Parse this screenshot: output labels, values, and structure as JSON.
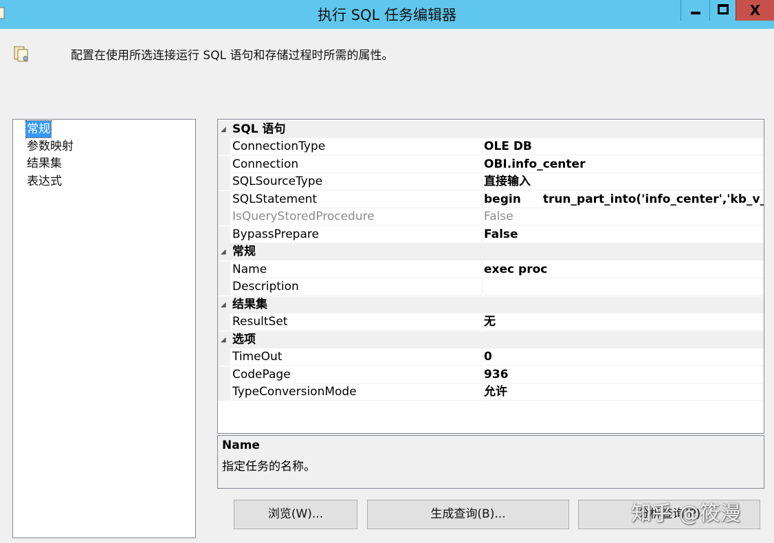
{
  "window": {
    "title": "执行 SQL 任务编辑器",
    "buttons": {
      "min_icon": "minimize-icon",
      "max_icon": "maximize-icon",
      "close_label": "X"
    }
  },
  "header": {
    "icon": "task-page-icon",
    "text": "配置在使用所选连接运行 SQL 语句和存储过程时所需的属性。"
  },
  "nav": {
    "items": [
      {
        "label": "常规",
        "selected": true
      },
      {
        "label": "参数映射",
        "selected": false
      },
      {
        "label": "结果集",
        "selected": false
      },
      {
        "label": "表达式",
        "selected": false
      }
    ]
  },
  "grid": {
    "categories": [
      {
        "label": "SQL 语句",
        "rows": [
          {
            "name": "ConnectionType",
            "value": "OLE DB"
          },
          {
            "name": "Connection",
            "value": "OBI.info_center"
          },
          {
            "name": "SQLSourceType",
            "value": "直接输入"
          },
          {
            "name": "SQLStatement",
            "value": "begin",
            "value2": "trun_part_into('info_center','kb_v_dr"
          },
          {
            "name": "IsQueryStoredProcedure",
            "value": "False",
            "disabled": true
          },
          {
            "name": "BypassPrepare",
            "value": "False"
          }
        ]
      },
      {
        "label": "常规",
        "rows": [
          {
            "name": "Name",
            "value": "exec proc"
          },
          {
            "name": "Description",
            "value": ""
          }
        ]
      },
      {
        "label": "结果集",
        "rows": [
          {
            "name": "ResultSet",
            "value": "无"
          }
        ]
      },
      {
        "label": "选项",
        "rows": [
          {
            "name": "TimeOut",
            "value": "0"
          },
          {
            "name": "CodePage",
            "value": "936"
          },
          {
            "name": "TypeConversionMode",
            "value": "允许"
          }
        ]
      }
    ]
  },
  "description": {
    "title": "Name",
    "text": "指定任务的名称。"
  },
  "buttons": {
    "browse": "浏览(W)...",
    "build_query": "生成查询(B)...",
    "parse_query": "分析查询(P)"
  },
  "watermark": "知乎 @筱漫",
  "colors": {
    "titlebar": "#5fc7ed",
    "close": "#c7504b",
    "selection": "#3399ff"
  }
}
